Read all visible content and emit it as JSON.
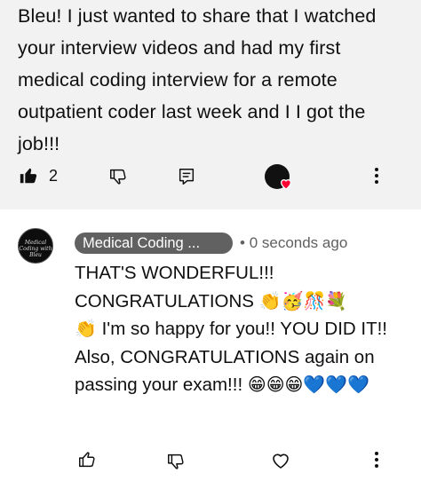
{
  "comment": {
    "text": "Bleu! I just wanted to share that I watched your interview videos and had my first medical coding interview for a remote outpatient coder last week and I I got the job!!!",
    "like_count": "2"
  },
  "reply": {
    "author": "Medical Coding ...",
    "separator": "•",
    "time": "0 seconds ago",
    "avatar_text": "Medical Coding with Bleu",
    "text_part1": "THAT'S WONDERFUL!!! CONGRATULATIONS ",
    "emoji_line1": "👏🥳🎊💐",
    "text_part2": " I'm so happy for you!! YOU DID IT!! Also, CONGRATULATIONS again on passing your exam!!! ",
    "emoji_start": "👏",
    "emoji_end": "😁😁😁💙💙💙"
  },
  "icons": {
    "like_filled": "thumbs-up-filled-icon",
    "dislike": "thumbs-down-icon",
    "reply": "reply-icon",
    "creator_heart": "creator-heart-icon",
    "more": "more-vertical-icon",
    "heart": "heart-icon"
  },
  "colors": {
    "top_background": "#f2f2f2",
    "chip_background": "#616161",
    "heart_red": "#ff0033",
    "emoji_blue": "#29a3e0"
  }
}
